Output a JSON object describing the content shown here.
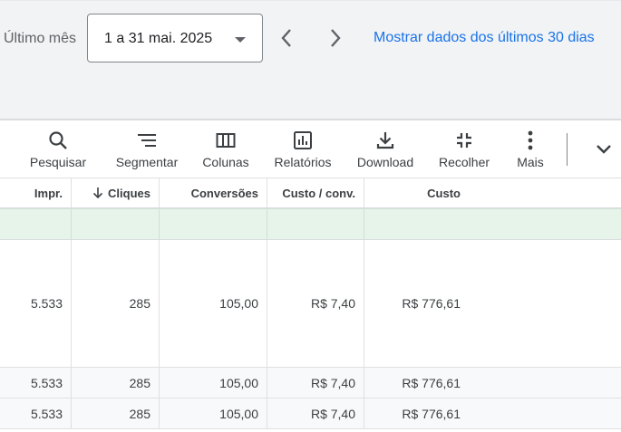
{
  "date_bar": {
    "period_label": "Último mês",
    "date_range": "1 a 31 mai. 2025",
    "show_last_30_link": "Mostrar dados dos últimos 30 dias"
  },
  "toolbar": {
    "search_label": "Pesquisar",
    "segment_label": "Segmentar",
    "columns_label": "Colunas",
    "reports_label": "Relatórios",
    "download_label": "Download",
    "collapse_label": "Recolher",
    "more_label": "Mais"
  },
  "table": {
    "headers": [
      "Impr.",
      "Cliques",
      "Conversões",
      "Custo / conv.",
      "Custo"
    ],
    "sorted_column": "Cliques",
    "rows": [
      [
        "5.533",
        "285",
        "105,00",
        "R$ 7,40",
        "R$ 776,61"
      ],
      [
        "5.533",
        "285",
        "105,00",
        "R$ 7,40",
        "R$ 776,61"
      ],
      [
        "5.533",
        "285",
        "105,00",
        "R$ 7,40",
        "R$ 776,61"
      ]
    ]
  },
  "colors": {
    "link": "#1a73e8",
    "total_row": "#e6f4ea",
    "date_bar_bg": "#f1f3f4"
  }
}
